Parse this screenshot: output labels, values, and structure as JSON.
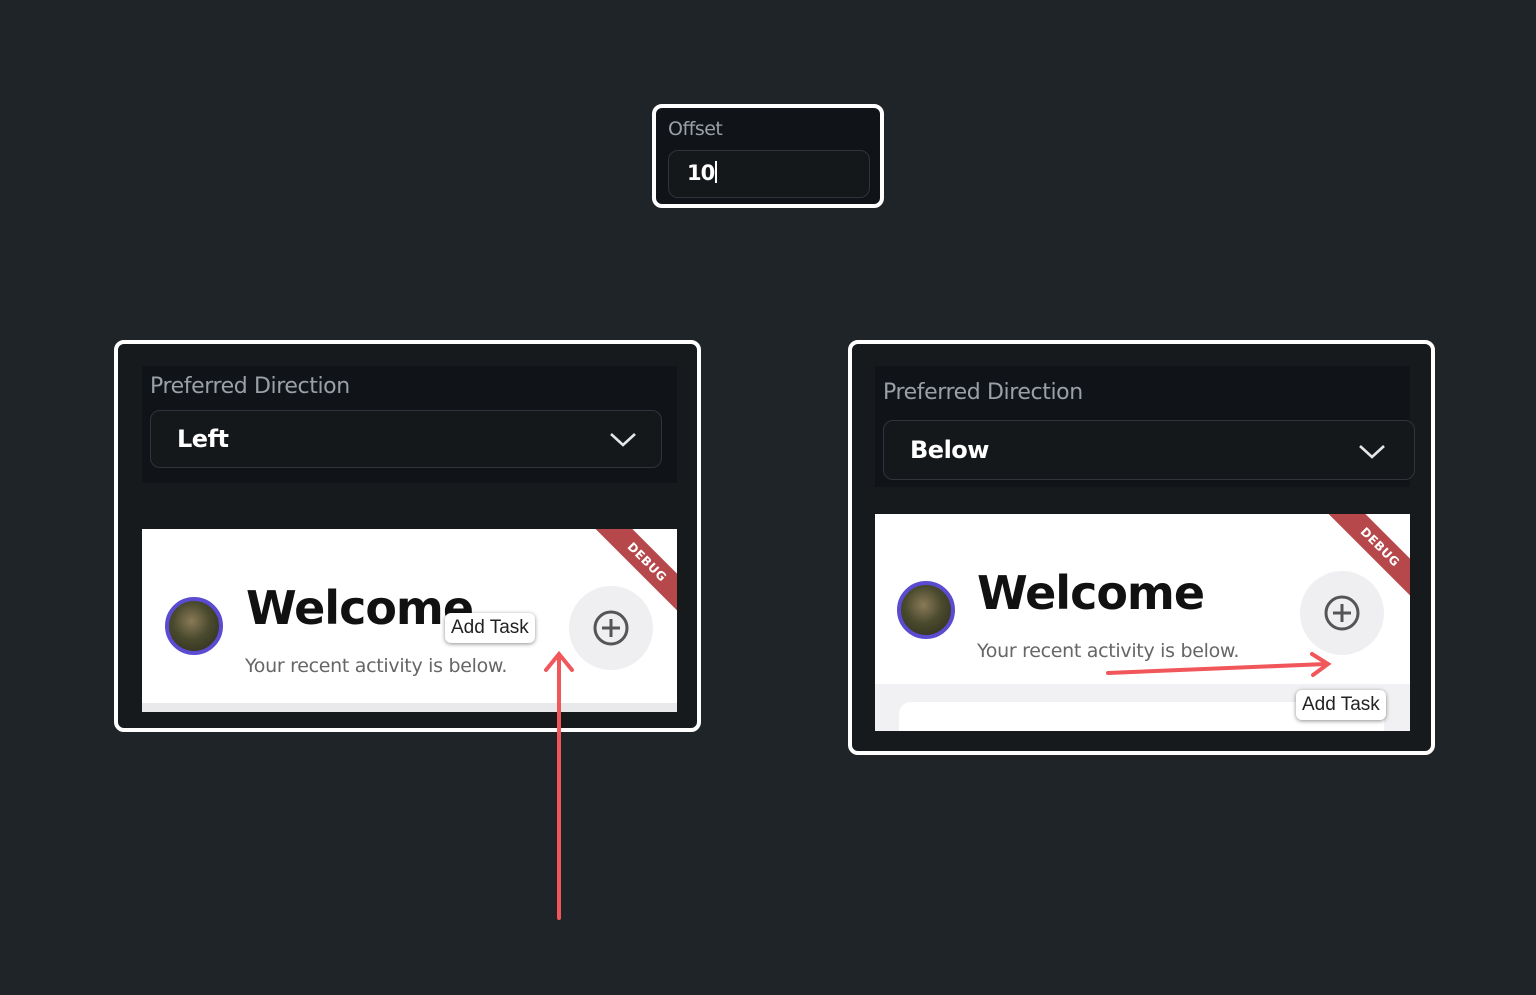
{
  "offset": {
    "label": "Offset",
    "value": "10"
  },
  "panels": [
    {
      "direction_label": "Preferred Direction",
      "direction_value": "Left",
      "preview": {
        "title": "Welcome",
        "subtitle": "Your recent activity is below.",
        "tooltip": "Add Task",
        "ribbon": "DEBUG"
      }
    },
    {
      "direction_label": "Preferred Direction",
      "direction_value": "Below",
      "preview": {
        "title": "Welcome",
        "subtitle": "Your recent activity is below.",
        "tooltip": "Add Task",
        "ribbon": "DEBUG"
      }
    }
  ],
  "colors": {
    "background": "#1f2428",
    "annotation_arrow": "#f0565a",
    "avatar_ring": "#5b4bd1",
    "debug_ribbon": "#b0383b"
  },
  "icons": [
    "chevron-down-icon",
    "add-circle-icon"
  ]
}
